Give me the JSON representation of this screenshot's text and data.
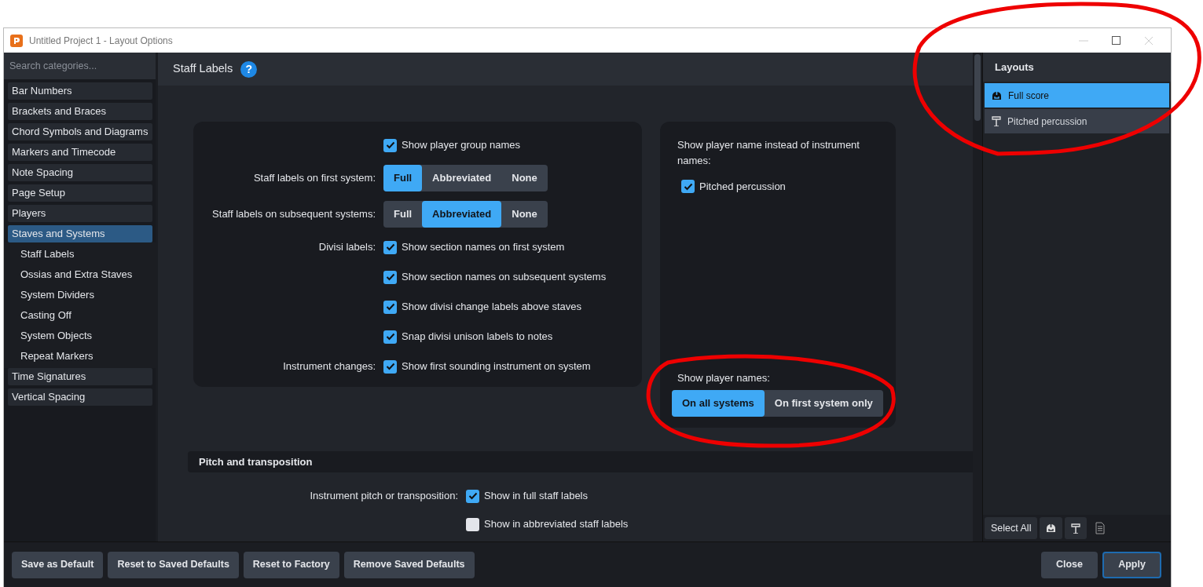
{
  "window": {
    "title": "Untitled Project 1 - Layout Options"
  },
  "sidebar": {
    "search": {
      "placeholder": "Search categories..."
    },
    "items": [
      {
        "label": "Bar Numbers",
        "selected": false
      },
      {
        "label": "Brackets and Braces",
        "selected": false
      },
      {
        "label": "Chord Symbols and Diagrams",
        "selected": false
      },
      {
        "label": "Markers and Timecode",
        "selected": false
      },
      {
        "label": "Note Spacing",
        "selected": false
      },
      {
        "label": "Page Setup",
        "selected": false
      },
      {
        "label": "Players",
        "selected": false
      },
      {
        "label": "Staves and Systems",
        "selected": true,
        "children": [
          {
            "label": "Staff Labels",
            "selected": false
          },
          {
            "label": "Ossias and Extra Staves",
            "selected": false
          },
          {
            "label": "System Dividers",
            "selected": false
          },
          {
            "label": "Casting Off",
            "selected": false
          },
          {
            "label": "System Objects",
            "selected": false
          },
          {
            "label": "Repeat Markers",
            "selected": false
          }
        ]
      },
      {
        "label": "Time Signatures",
        "selected": false
      },
      {
        "label": "Vertical Spacing",
        "selected": false
      }
    ]
  },
  "page": {
    "title": "Staff Labels",
    "help": "?"
  },
  "options": [
    {
      "kind": "checkbox",
      "text": "Show player group names",
      "checked": true
    },
    {
      "kind": "segmented",
      "label": "Staff labels on first system:",
      "options": [
        {
          "label": "Full",
          "selected": true
        },
        {
          "label": "Abbreviated",
          "selected": false
        },
        {
          "label": "None",
          "selected": false
        }
      ]
    },
    {
      "kind": "segmented",
      "label": "Staff labels on subsequent systems:",
      "options": [
        {
          "label": "Full",
          "selected": false
        },
        {
          "label": "Abbreviated",
          "selected": true
        },
        {
          "label": "None",
          "selected": false
        }
      ]
    },
    {
      "kind": "checkbox",
      "label": "Divisi labels:",
      "text": "Show section names on first system",
      "checked": true
    },
    {
      "kind": "checkbox",
      "text": "Show section names on subsequent systems",
      "checked": true
    },
    {
      "kind": "checkbox",
      "text": "Show divisi change labels above staves",
      "checked": true
    },
    {
      "kind": "checkbox",
      "text": "Snap divisi unison labels to notes",
      "checked": true
    },
    {
      "kind": "checkbox",
      "label": "Instrument changes:",
      "text": "Show first sounding instrument on system",
      "checked": true
    }
  ],
  "player_name_panel": {
    "heading": "Show player name instead of instrument names:",
    "items": [
      {
        "text": "Pitched percussion",
        "checked": true
      }
    ],
    "show_player_names": {
      "label": "Show player names:",
      "options": [
        {
          "label": "On all systems",
          "selected": true
        },
        {
          "label": "On first system only",
          "selected": false
        }
      ]
    }
  },
  "sections": [
    {
      "title": "Pitch and transposition",
      "rows": [
        {
          "kind": "checkbox",
          "label": "Instrument pitch or transposition:",
          "text": "Show in full staff labels",
          "checked": true
        },
        {
          "kind": "checkbox",
          "text": "Show in abbreviated staff labels",
          "checked": false
        }
      ]
    }
  ],
  "layouts": {
    "title": "Layouts",
    "items": [
      {
        "label": "Full score",
        "kind": "full",
        "selected": true
      },
      {
        "label": "Pitched percussion",
        "kind": "part",
        "selected": false
      }
    ],
    "toolbar": {
      "select_all": "Select All",
      "tools": [
        {
          "kind": "full"
        },
        {
          "kind": "part"
        },
        {
          "kind": "document"
        }
      ]
    }
  },
  "footer": {
    "left_buttons": [
      "Save as Default",
      "Reset to Saved Defaults",
      "Reset to Factory",
      "Remove Saved Defaults"
    ],
    "right_buttons": [
      {
        "label": "Close",
        "kind": "default"
      },
      {
        "label": "Apply",
        "kind": "primary"
      }
    ]
  }
}
